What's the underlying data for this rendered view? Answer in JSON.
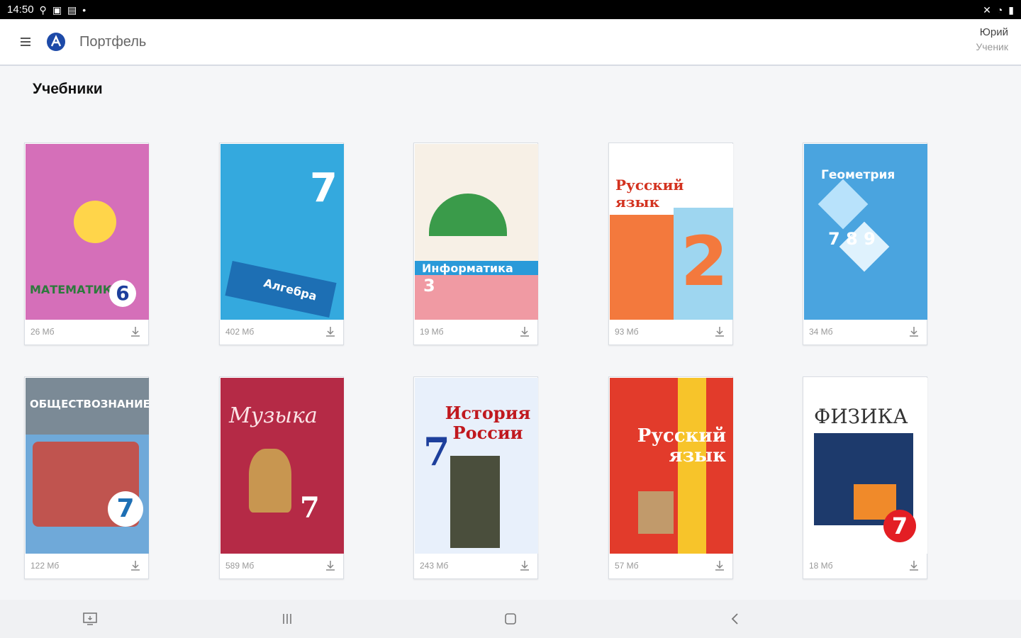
{
  "status": {
    "time": "14:50"
  },
  "appbar": {
    "title": "Портфель",
    "user_name": "Юрий",
    "user_role": "Ученик"
  },
  "section": {
    "title": "Учебники"
  },
  "books": [
    {
      "cover_title": "МАТЕМАТИКА",
      "grade": "6",
      "size": "26 Мб",
      "color": "#d56fb9"
    },
    {
      "cover_title": "Алгебра",
      "grade": "7",
      "size": "402 Мб",
      "color": "#34a9de"
    },
    {
      "cover_title": "Информатика",
      "grade": "3",
      "size": "19 Мб",
      "color": "#f09aa3"
    },
    {
      "cover_title": "Русский язык",
      "grade": "2",
      "size": "93 Мб",
      "color": "#f3793d"
    },
    {
      "cover_title": "Геометрия",
      "grade": "7 8 9",
      "size": "34 Мб",
      "color": "#4aa4df"
    },
    {
      "cover_title": "ОБЩЕСТВОЗНАНИЕ",
      "grade": "7",
      "size": "122 Мб",
      "color": "#6fa9d9"
    },
    {
      "cover_title": "Музыка",
      "grade": "7",
      "size": "589 Мб",
      "color": "#b52a46"
    },
    {
      "cover_title": "История России",
      "grade": "7",
      "size": "243 Мб",
      "color": "#e8f0fb"
    },
    {
      "cover_title": "Русский язык",
      "grade": "",
      "size": "57 Мб",
      "color": "#e23b2b"
    },
    {
      "cover_title": "ФИЗИКА",
      "grade": "7",
      "size": "18 Мб",
      "color": "#ffffff"
    }
  ]
}
